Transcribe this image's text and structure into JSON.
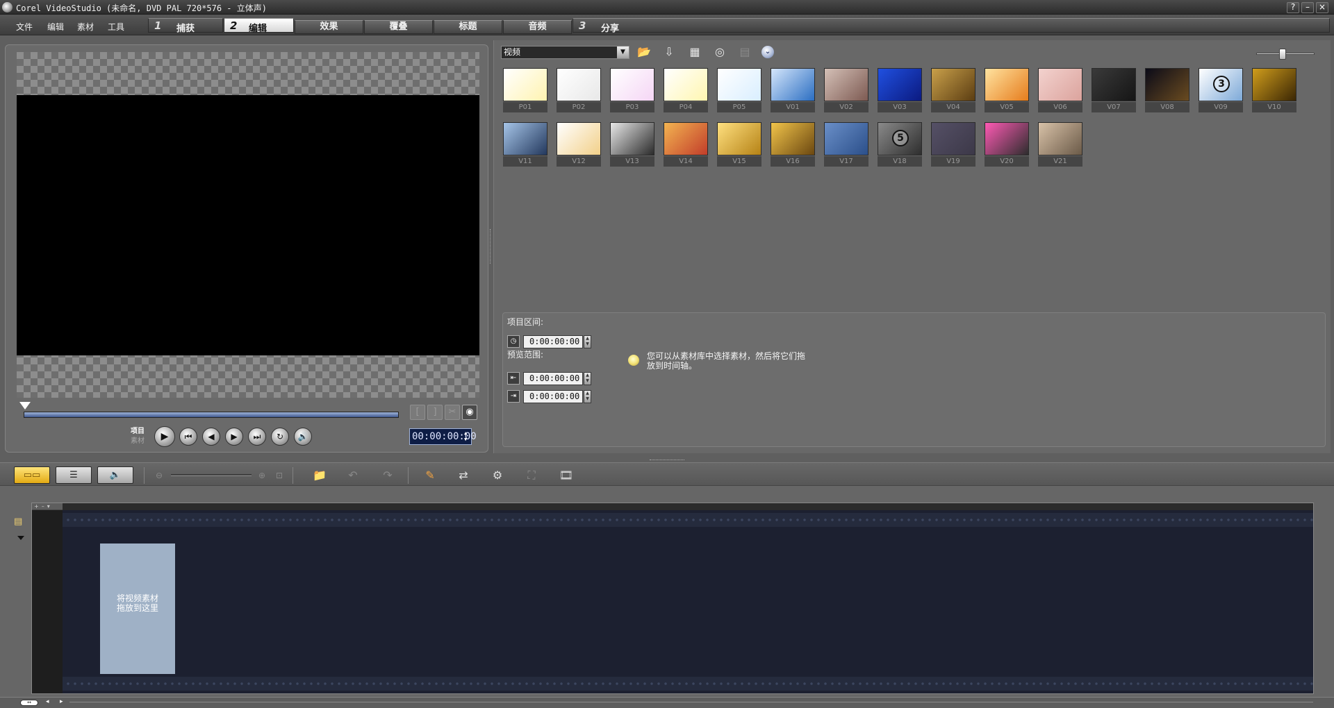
{
  "window": {
    "title": "Corel VideoStudio (未命名, DVD PAL 720*576 - 立体声)",
    "buttons": {
      "help": "?",
      "minimize": "–",
      "close": "×"
    }
  },
  "menu": {
    "items": [
      "文件",
      "编辑",
      "素材",
      "工具"
    ]
  },
  "steps": [
    {
      "num": "1",
      "label": "捕获"
    },
    {
      "num": "2",
      "label": "编辑"
    },
    {
      "num": "3",
      "label": "分享"
    }
  ],
  "active_step": "编辑",
  "subtabs": [
    "效果",
    "覆叠",
    "标题",
    "音频"
  ],
  "preview": {
    "mode_project": "项目",
    "mode_clip": "素材",
    "timecode": "00:00:00:00",
    "trim_buttons": [
      "[",
      "]",
      "✂",
      "◉"
    ],
    "playback_buttons": [
      "▶",
      "⏮",
      "◀",
      "▶",
      "⏭",
      "↻",
      "🔊"
    ]
  },
  "library": {
    "category": "视频",
    "toolbar_icons": [
      "folder-open-icon",
      "import-icon",
      "sort-icon",
      "capture-icon",
      "options-icon",
      "expand-icon"
    ],
    "thumbnails": [
      {
        "label": "P01",
        "colors": [
          "#ffffff",
          "#fff3b0"
        ]
      },
      {
        "label": "P02",
        "colors": [
          "#ffffff",
          "#e8e8e8"
        ]
      },
      {
        "label": "P03",
        "colors": [
          "#ffffff",
          "#f5d6f5"
        ]
      },
      {
        "label": "P04",
        "colors": [
          "#ffffff",
          "#fff6b0"
        ]
      },
      {
        "label": "P05",
        "colors": [
          "#ffffff",
          "#d9eeff"
        ]
      },
      {
        "label": "V01",
        "colors": [
          "#d5e6fb",
          "#2b6ec2"
        ]
      },
      {
        "label": "V02",
        "colors": [
          "#d4c0b7",
          "#7d5a52"
        ]
      },
      {
        "label": "V03",
        "colors": [
          "#2050e0",
          "#0b1a80"
        ]
      },
      {
        "label": "V04",
        "colors": [
          "#c9a04a",
          "#5b3d12"
        ]
      },
      {
        "label": "V05",
        "colors": [
          "#ffe3a0",
          "#e67c1c"
        ]
      },
      {
        "label": "V06",
        "colors": [
          "#f3d2ce",
          "#dba39d"
        ]
      },
      {
        "label": "V07",
        "colors": [
          "#3a3a3a",
          "#151515"
        ]
      },
      {
        "label": "V08",
        "colors": [
          "#0b0b18",
          "#6a4b20"
        ]
      },
      {
        "label": "V09",
        "colors": [
          "#ffffff",
          "#7da9d8"
        ]
      },
      {
        "label": "V10",
        "colors": [
          "#d09d1c",
          "#3a2604"
        ]
      },
      {
        "label": "V11",
        "colors": [
          "#a6c5e8",
          "#23385d"
        ]
      },
      {
        "label": "V12",
        "colors": [
          "#ffffff",
          "#f2d089"
        ]
      },
      {
        "label": "V13",
        "colors": [
          "#e8e8e8",
          "#2b2b2b"
        ]
      },
      {
        "label": "V14",
        "colors": [
          "#f3b451",
          "#c23d2a"
        ]
      },
      {
        "label": "V15",
        "colors": [
          "#ffe080",
          "#b58215"
        ]
      },
      {
        "label": "V16",
        "colors": [
          "#f1c44a",
          "#6b4710"
        ]
      },
      {
        "label": "V17",
        "colors": [
          "#6a8fc8",
          "#2b4f8a"
        ]
      },
      {
        "label": "V18",
        "colors": [
          "#8a8a8a",
          "#2e2e2e"
        ]
      },
      {
        "label": "V19",
        "colors": [
          "#555066",
          "#3c3848"
        ]
      },
      {
        "label": "V20",
        "colors": [
          "#ff5ab4",
          "#2d2d2d"
        ]
      },
      {
        "label": "V21",
        "colors": [
          "#d8c2a8",
          "#6b5a48"
        ]
      }
    ],
    "thumb_badges": {
      "V09": "3",
      "V18": "5"
    }
  },
  "info": {
    "duration_label": "项目区间:",
    "range_label": "预览范围:",
    "duration_value": "0:00:00:00",
    "range_start": "0:00:00:00",
    "range_end": "0:00:00:00",
    "hint": "您可以从素材库中选择素材，然后将它们拖放到时间轴。"
  },
  "timeline": {
    "view_buttons": [
      "storyboard-view",
      "timeline-view",
      "audio-view"
    ],
    "view_glyphs": [
      "▭▭",
      "☰",
      "🔈"
    ],
    "drop_hint_line1": "将视频素材",
    "drop_hint_line2": "拖放到这里",
    "header_glyphs": "+–▾",
    "status_glyph": "◂▸"
  },
  "accent": {
    "active_view": "#f2be2c",
    "timecode_bg": "#0e1d45",
    "drop_zone": "#9fb1c6"
  }
}
